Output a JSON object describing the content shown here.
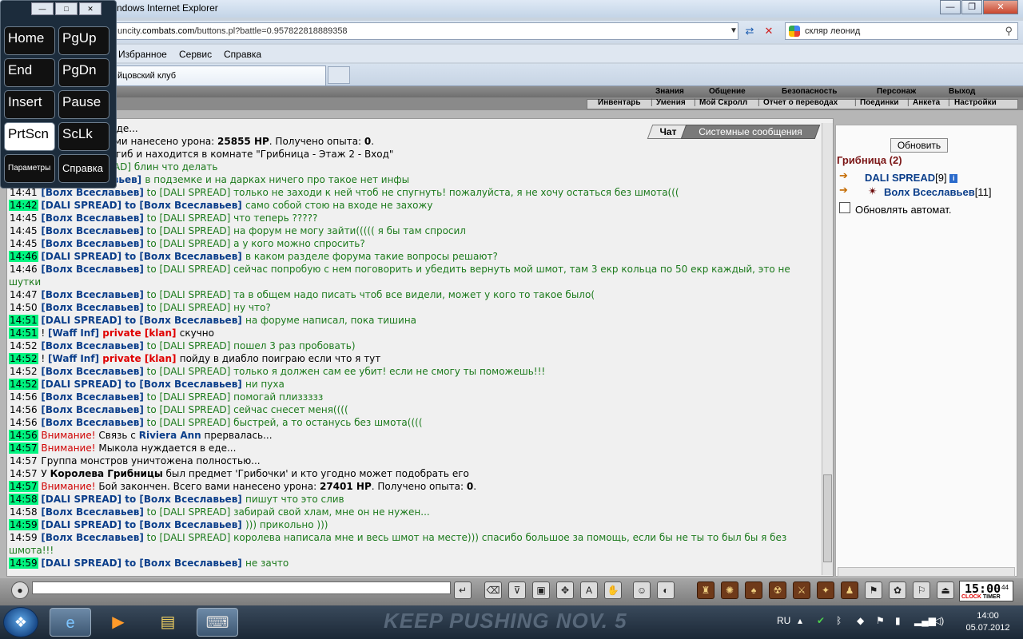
{
  "window": {
    "title": "ndows Internet Explorer",
    "controls": [
      "—",
      "❐",
      "✕"
    ]
  },
  "address": {
    "url_prefix": "uncity.",
    "url_host": "combats.com",
    "url_path": "/buttons.pl?battle=0.957822818889358",
    "search_query": "скляр леонид"
  },
  "menu": [
    "Избранное",
    "Сервис",
    "Справка"
  ],
  "tab": {
    "title": "йцовский клуб"
  },
  "game": {
    "top_nav": [
      "Знания",
      "Общение",
      "Безопасность",
      "Персонаж",
      "Выход"
    ],
    "sub_nav": [
      "Инвентарь",
      "Умения",
      "Мой Скролл",
      "Отчет о переводах",
      "Поединки",
      "Анкета",
      "Настройки"
    ],
    "chat_tabs": {
      "chat": "Чат",
      "system": "Системные сообщения"
    },
    "right": {
      "refresh_label": "Обновить",
      "room": "Грибница (2)",
      "players": [
        {
          "name": "DALI SPREAD",
          "level": "[9]"
        },
        {
          "name": "Волх Всеславьев",
          "level": "[11]"
        }
      ],
      "auto_label": "Обновлять автомат."
    },
    "clock": {
      "time": "15:00",
      "seconds": "44",
      "label_a": "CLOCK",
      "label_b": "TIMER"
    },
    "chat": [
      {
        "ts": "",
        "parts": [
          {
            "t": "ыкола нуждается в еде...",
            "c": "sys"
          }
        ]
      },
      {
        "ts": "",
        "parts": [
          {
            "t": "й закончен. Всего вами нанесено урона: ",
            "c": "sys"
          },
          {
            "t": "25855 HP",
            "c": "bold"
          },
          {
            "t": ". Получено опыта: ",
            "c": "sys"
          },
          {
            "t": "0",
            "c": "bold"
          },
          {
            "t": ".",
            "c": "sys"
          }
        ]
      },
      {
        "ts": "",
        "parts": [
          {
            "t": "авьев",
            "c": "bold"
          },
          {
            "t": " трагически погиб и находится в комнате \"Грибница - Этаж 2 - Вход\"",
            "c": "sys"
          }
        ]
      },
      {
        "ts": "",
        "parts": [
          {
            "t": "авьев]",
            "c": "nm"
          },
          {
            "t": " to [DALI SPREAD] ",
            "c": "pre"
          },
          {
            "t": "блин что делать",
            "c": "pm"
          }
        ]
      },
      {
        "ts": "",
        "parts": [
          {
            "t": "D]",
            "c": "nm"
          },
          {
            "t": " to [Волх Всеславьев] ",
            "c": "to"
          },
          {
            "t": "в подземке и на дарках ничего про такое нет инфы",
            "c": "pm"
          }
        ]
      },
      {
        "ts": "14:41",
        "hl": false,
        "parts": [
          {
            "t": "[Волх Всеславьев]",
            "c": "nm"
          },
          {
            "t": " to [DALI SPREAD] ",
            "c": "pre"
          },
          {
            "t": "только не заходи к ней чтоб не спугнуть! пожалуйста, я не хочу остаться без шмота(((",
            "c": "pm"
          }
        ]
      },
      {
        "ts": "14:42",
        "hl": true,
        "parts": [
          {
            "t": "[DALI SPREAD]",
            "c": "nm"
          },
          {
            "t": " to [Волх Всеславьев] ",
            "c": "to"
          },
          {
            "t": "само собой стою на входе не захожу",
            "c": "pm"
          }
        ]
      },
      {
        "ts": "14:45",
        "hl": false,
        "parts": [
          {
            "t": "[Волх Всеславьев]",
            "c": "nm"
          },
          {
            "t": " to [DALI SPREAD] ",
            "c": "pre"
          },
          {
            "t": "что теперь ?????",
            "c": "pm"
          }
        ]
      },
      {
        "ts": "14:45",
        "hl": false,
        "parts": [
          {
            "t": "[Волх Всеславьев]",
            "c": "nm"
          },
          {
            "t": " to [DALI SPREAD] ",
            "c": "pre"
          },
          {
            "t": "на форум не могу зайти((((( я бы там спросил",
            "c": "pm"
          }
        ]
      },
      {
        "ts": "14:45",
        "hl": false,
        "parts": [
          {
            "t": "[Волх Всеславьев]",
            "c": "nm"
          },
          {
            "t": " to [DALI SPREAD] ",
            "c": "pre"
          },
          {
            "t": "а у кого можно спросить?",
            "c": "pm"
          }
        ]
      },
      {
        "ts": "14:46",
        "hl": true,
        "parts": [
          {
            "t": "[DALI SPREAD]",
            "c": "nm"
          },
          {
            "t": " to [Волх Всеславьев] ",
            "c": "to"
          },
          {
            "t": "в каком разделе форума такие вопросы решают?",
            "c": "pm"
          }
        ]
      },
      {
        "ts": "14:46",
        "hl": false,
        "parts": [
          {
            "t": "[Волх Всеславьев]",
            "c": "nm"
          },
          {
            "t": " to [DALI SPREAD] ",
            "c": "pre"
          },
          {
            "t": "сейчас попробую с нем поговорить и убедить вернуть мой шмот, там 3 екр кольца по 50 екр каждый, это не шутки",
            "c": "pm"
          }
        ]
      },
      {
        "ts": "14:47",
        "hl": false,
        "parts": [
          {
            "t": "[Волх Всеславьев]",
            "c": "nm"
          },
          {
            "t": " to [DALI SPREAD] ",
            "c": "pre"
          },
          {
            "t": "та в общем надо писать чтоб все видели, может у кого то такое было(",
            "c": "pm"
          }
        ]
      },
      {
        "ts": "14:50",
        "hl": false,
        "parts": [
          {
            "t": "[Волх Всеславьев]",
            "c": "nm"
          },
          {
            "t": " to [DALI SPREAD] ",
            "c": "pre"
          },
          {
            "t": "ну что?",
            "c": "pm"
          }
        ]
      },
      {
        "ts": "14:51",
        "hl": true,
        "parts": [
          {
            "t": "[DALI SPREAD]",
            "c": "nm"
          },
          {
            "t": " to [Волх Всеславьев] ",
            "c": "to"
          },
          {
            "t": "на форуме написал, пока тишина",
            "c": "pm"
          }
        ]
      },
      {
        "ts": "14:51",
        "hl": true,
        "parts": [
          {
            "t": "! ",
            "c": "sys"
          },
          {
            "t": "[Waff Inf]",
            "c": "nm"
          },
          {
            "t": " private [klan] ",
            "c": "priv"
          },
          {
            "t": "скучно",
            "c": "sys"
          }
        ]
      },
      {
        "ts": "14:52",
        "hl": false,
        "parts": [
          {
            "t": "[Волх Всеславьев]",
            "c": "nm"
          },
          {
            "t": " to [DALI SPREAD] ",
            "c": "pre"
          },
          {
            "t": "пошел 3 раз пробовать)",
            "c": "pm"
          }
        ]
      },
      {
        "ts": "14:52",
        "hl": true,
        "parts": [
          {
            "t": "! ",
            "c": "sys"
          },
          {
            "t": "[Waff Inf]",
            "c": "nm"
          },
          {
            "t": " private [klan] ",
            "c": "priv"
          },
          {
            "t": "пойду в диабло поиграю если что я тут",
            "c": "sys"
          }
        ]
      },
      {
        "ts": "14:52",
        "hl": false,
        "parts": [
          {
            "t": "[Волх Всеславьев]",
            "c": "nm"
          },
          {
            "t": " to [DALI SPREAD] ",
            "c": "pre"
          },
          {
            "t": "только я должен сам ее убит! если не смогу ты поможешь!!!",
            "c": "pm"
          }
        ]
      },
      {
        "ts": "14:52",
        "hl": true,
        "parts": [
          {
            "t": "[DALI SPREAD]",
            "c": "nm"
          },
          {
            "t": " to [Волх Всеславьев] ",
            "c": "to"
          },
          {
            "t": "ни пуха",
            "c": "pm"
          }
        ]
      },
      {
        "ts": "14:56",
        "hl": false,
        "parts": [
          {
            "t": "[Волх Всеславьев]",
            "c": "nm"
          },
          {
            "t": " to [DALI SPREAD] ",
            "c": "pre"
          },
          {
            "t": "помогай плиззззз",
            "c": "pm"
          }
        ]
      },
      {
        "ts": "14:56",
        "hl": false,
        "parts": [
          {
            "t": "[Волх Всеславьев]",
            "c": "nm"
          },
          {
            "t": " to [DALI SPREAD] ",
            "c": "pre"
          },
          {
            "t": "сейчас снесет меня((((",
            "c": "pm"
          }
        ]
      },
      {
        "ts": "14:56",
        "hl": false,
        "parts": [
          {
            "t": "[Волх Всеславьев]",
            "c": "nm"
          },
          {
            "t": " to [DALI SPREAD] ",
            "c": "pre"
          },
          {
            "t": "быстрей, а то останусь без шмота((((",
            "c": "pm"
          }
        ]
      },
      {
        "ts": "14:56",
        "hl": true,
        "parts": [
          {
            "t": "Внимание!",
            "c": "warn"
          },
          {
            "t": " Связь с ",
            "c": "sys"
          },
          {
            "t": "Riviera Ann",
            "c": "nm"
          },
          {
            "t": " прервалась...",
            "c": "sys"
          }
        ]
      },
      {
        "ts": "14:57",
        "hl": true,
        "parts": [
          {
            "t": "Внимание!",
            "c": "warn"
          },
          {
            "t": " Мыкола нуждается в еде...",
            "c": "sys"
          }
        ]
      },
      {
        "ts": "14:57",
        "hl": false,
        "parts": [
          {
            "t": "Группа монстров уничтожена полностью...",
            "c": "sys"
          }
        ]
      },
      {
        "ts": "14:57",
        "hl": false,
        "parts": [
          {
            "t": "У ",
            "c": "sys"
          },
          {
            "t": "Королева Грибницы",
            "c": "bold"
          },
          {
            "t": " был предмет 'Грибочки' и кто угодно может подобрать его",
            "c": "sys"
          }
        ]
      },
      {
        "ts": "14:57",
        "hl": true,
        "parts": [
          {
            "t": "Внимание!",
            "c": "warn"
          },
          {
            "t": " Бой закончен. Всего вами нанесено урона: ",
            "c": "sys"
          },
          {
            "t": "27401 HP",
            "c": "bold"
          },
          {
            "t": ". Получено опыта: ",
            "c": "sys"
          },
          {
            "t": "0",
            "c": "bold"
          },
          {
            "t": ".",
            "c": "sys"
          }
        ]
      },
      {
        "ts": "14:58",
        "hl": true,
        "parts": [
          {
            "t": "[DALI SPREAD]",
            "c": "nm"
          },
          {
            "t": " to [Волх Всеславьев] ",
            "c": "to"
          },
          {
            "t": "пишут что это слив",
            "c": "pm"
          }
        ]
      },
      {
        "ts": "14:58",
        "hl": false,
        "parts": [
          {
            "t": "[Волх Всеславьев]",
            "c": "nm"
          },
          {
            "t": " to [DALI SPREAD] ",
            "c": "pre"
          },
          {
            "t": "забирай свой хлам, мне он не нужен...",
            "c": "pm"
          }
        ]
      },
      {
        "ts": "14:59",
        "hl": true,
        "parts": [
          {
            "t": "[DALI SPREAD]",
            "c": "nm"
          },
          {
            "t": " to [Волх Всеславьев] ",
            "c": "to"
          },
          {
            "t": "))) прикольно )))",
            "c": "pm"
          }
        ]
      },
      {
        "ts": "14:59",
        "hl": false,
        "parts": [
          {
            "t": "[Волх Всеславьев]",
            "c": "nm"
          },
          {
            "t": " to [DALI SPREAD] ",
            "c": "pre"
          },
          {
            "t": "королева написала мне и весь шмот на месте))) спасибо большое за помощь, если бы не ты то был бы я без шмота!!!",
            "c": "pm"
          }
        ]
      },
      {
        "ts": "14:59",
        "hl": true,
        "parts": [
          {
            "t": "[DALI SPREAD]",
            "c": "nm"
          },
          {
            "t": " to [Волх Всеславьев] ",
            "c": "to"
          },
          {
            "t": "не зачто",
            "c": "pm"
          }
        ]
      }
    ]
  },
  "osk": {
    "keys": [
      "Home",
      "PgUp",
      "End",
      "PgDn",
      "Insert",
      "Pause",
      "PrtScn",
      "ScLk",
      "Параметры",
      "Справка"
    ]
  },
  "taskbar": {
    "wallpaper_text": "KEEP PUSHING NOV. 5",
    "lang": "RU",
    "time": "14:00",
    "date": "05.07.2012"
  }
}
